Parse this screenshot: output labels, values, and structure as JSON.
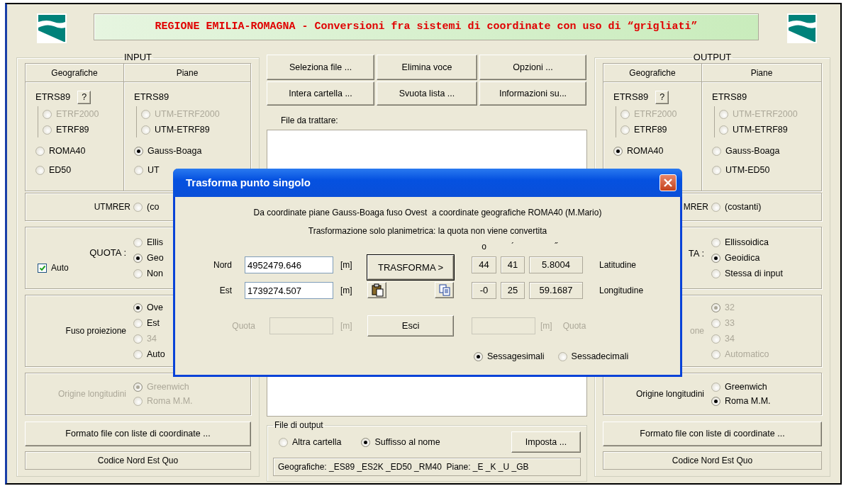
{
  "header": {
    "title": "REGIONE EMILIA-ROMAGNA - Conversioni fra sistemi di coordinate con uso di “grigliati”"
  },
  "input": {
    "legend": "INPUT",
    "systems": [
      {
        "heading": "Geografiche",
        "title": "ETRS89",
        "help": "?",
        "options": [
          {
            "label": "ETRF2000",
            "kind": "sub",
            "selected": false,
            "disabled": true
          },
          {
            "label": "ETRF89",
            "kind": "sub",
            "selected": false,
            "disabled": false
          },
          {
            "label": "ROMA40",
            "kind": "main",
            "selected": false,
            "disabled": false
          },
          {
            "label": "ED50",
            "kind": "main",
            "selected": false,
            "disabled": false
          }
        ]
      },
      {
        "heading": "Piane",
        "title": "ETRS89",
        "options": [
          {
            "label": "UTM-ETRF2000",
            "kind": "sub",
            "selected": false,
            "disabled": true
          },
          {
            "label": "UTM-ETRF89",
            "kind": "sub",
            "selected": false,
            "disabled": false
          },
          {
            "label": "Gauss-Boaga",
            "kind": "main",
            "selected": true,
            "disabled": false
          },
          {
            "label": "UT",
            "kind": "main",
            "selected": false,
            "disabled": false
          }
        ]
      }
    ],
    "utmrer": {
      "label": "UTMRER",
      "option": {
        "label": "(co",
        "selected": false
      }
    },
    "quota": {
      "label": "QUOTA :",
      "auto": {
        "label": "Auto",
        "checked": true
      },
      "options": [
        {
          "label": "Ellis",
          "selected": false,
          "disabled": false
        },
        {
          "label": "Geo",
          "selected": true,
          "disabled": false
        },
        {
          "label": "Non",
          "selected": false,
          "disabled": false
        }
      ]
    },
    "fuso": {
      "label": "Fuso proiezione",
      "disabled": false,
      "options": [
        {
          "label": "Ove",
          "selected": true,
          "disabled": false
        },
        {
          "label": "Est",
          "selected": false,
          "disabled": false
        },
        {
          "label": "34",
          "selected": false,
          "disabled": true
        },
        {
          "label": "Auto",
          "selected": false,
          "disabled": false
        }
      ]
    },
    "origine": {
      "label": "Origine longitudini",
      "disabled": true,
      "options": [
        {
          "label": "Greenwich",
          "selected": true,
          "disabled": true
        },
        {
          "label": "Roma M.M.",
          "selected": false,
          "disabled": true
        }
      ]
    },
    "format_button": "Formato file con liste di coordinate ...",
    "format_value": "Codice Nord Est Quo"
  },
  "center": {
    "buttons": [
      "Seleziona file ...",
      "Elimina voce",
      "Opzioni ...",
      "Intera cartella ...",
      "Svuota lista ...",
      "Informazioni su..."
    ],
    "file_list": {
      "label": "File da trattare:"
    },
    "file_output": {
      "legend": "File di output",
      "options": [
        {
          "label": "Altra cartella",
          "selected": false
        },
        {
          "label": "Suffisso al nome",
          "selected": true
        }
      ],
      "button": "Imposta ...",
      "value": "Geografiche: _ES89 _ES2K _ED50 _RM40  Piane: _E _K _U _GB"
    }
  },
  "output": {
    "legend": "OUTPUT",
    "systems": [
      {
        "heading": "Geografiche",
        "title": "ETRS89",
        "help": "?",
        "options": [
          {
            "label": "ETRF2000",
            "kind": "sub",
            "selected": false,
            "disabled": true
          },
          {
            "label": "ETRF89",
            "kind": "sub",
            "selected": false,
            "disabled": false
          },
          {
            "label": "ROMA40",
            "kind": "main",
            "selected": true,
            "disabled": false
          }
        ]
      },
      {
        "heading": "Piane",
        "title": "ETRS89",
        "options": [
          {
            "label": "UTM-ETRF2000",
            "kind": "sub",
            "selected": false,
            "disabled": true
          },
          {
            "label": "UTM-ETRF89",
            "kind": "sub",
            "selected": false,
            "disabled": false
          },
          {
            "label": "Gauss-Boaga",
            "kind": "main",
            "selected": false,
            "disabled": false
          },
          {
            "label": "UTM-ED50",
            "kind": "main",
            "selected": false,
            "disabled": false
          }
        ]
      }
    ],
    "utmrer": {
      "label": "MRER",
      "option": {
        "label": "(costanti)",
        "selected": false
      }
    },
    "quota": {
      "label": "TA :",
      "options": [
        {
          "label": "Ellissoidica",
          "selected": false,
          "disabled": false
        },
        {
          "label": "Geoidica",
          "selected": true,
          "disabled": false
        },
        {
          "label": "Stessa di input",
          "selected": false,
          "disabled": false
        }
      ]
    },
    "fuso": {
      "label": "one",
      "disabled": true,
      "options": [
        {
          "label": "32",
          "selected": true,
          "disabled": true
        },
        {
          "label": "33",
          "selected": false,
          "disabled": true
        },
        {
          "label": "34",
          "selected": false,
          "disabled": true
        },
        {
          "label": "Automatico",
          "selected": false,
          "disabled": true
        }
      ]
    },
    "origine": {
      "label": "Origine longitudini",
      "disabled": false,
      "options": [
        {
          "label": "Greenwich",
          "selected": false,
          "disabled": false
        },
        {
          "label": "Roma M.M.",
          "selected": true,
          "disabled": false
        }
      ]
    },
    "format_button": "Formato file con liste di coordinate ...",
    "format_value": "Codice Nord Est Quo"
  },
  "dialog": {
    "title": "Trasforma punto singolo",
    "lines": [
      "Da coordinate piane Gauss-Boaga fuso Ovest  a coordinate geografiche ROMA40 (M.Mario)",
      "Trasformazione solo planimetrica: la quota non viene convertita"
    ],
    "angle_headers": [
      "o",
      "´",
      "˝"
    ],
    "rows": [
      {
        "label": "Nord",
        "value": "4952479.646",
        "unit": "[m]",
        "result": [
          "44",
          "41",
          "5.8004"
        ],
        "result_label": "Latitudine"
      },
      {
        "label": "Est",
        "value": "1739274.507",
        "unit": "[m]",
        "result": [
          "-0",
          "25",
          "59.1687"
        ],
        "result_label": "Longitudine"
      }
    ],
    "transform_button": "TRASFORMA >",
    "exit_button": "Esci",
    "quota_in": {
      "label": "Quota",
      "unit": "[m]",
      "disabled": true
    },
    "quota_out": {
      "label": "Quota",
      "unit": "[m]",
      "disabled": true
    },
    "formats": [
      {
        "label": "Sessagesimali",
        "selected": true
      },
      {
        "label": "Sessadecimali",
        "selected": false
      }
    ]
  }
}
